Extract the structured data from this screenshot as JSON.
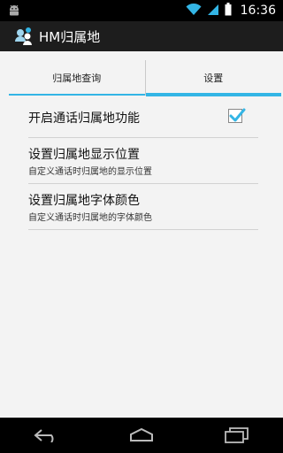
{
  "status_bar": {
    "time": "16:36"
  },
  "action_bar": {
    "title": "HM归属地"
  },
  "tabs": [
    {
      "label": "归属地查询"
    },
    {
      "label": "设置"
    }
  ],
  "settings": {
    "enable": {
      "label": "开启通话归属地功能",
      "checked": true
    },
    "position": {
      "label": "设置归属地显示位置",
      "summary": "自定义通话时归属地的显示位置"
    },
    "font_color": {
      "label": "设置归属地字体颜色",
      "summary": "自定义通话时归属地的字体颜色"
    }
  },
  "colors": {
    "accent": "#33b5e5",
    "background": "#f3f3f3",
    "action_bar": "#1d1d1d"
  }
}
